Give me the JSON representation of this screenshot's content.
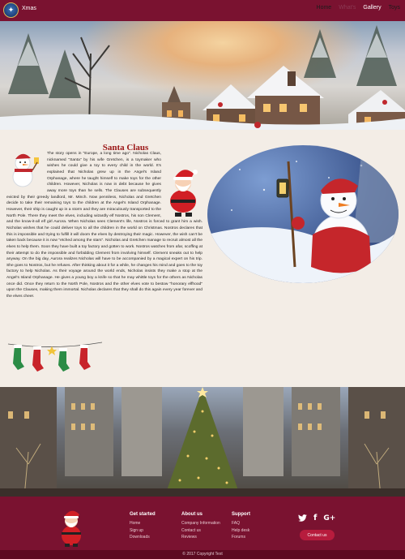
{
  "nav": {
    "brand": "Xmas",
    "items": [
      {
        "label": "Home"
      },
      {
        "label": "What's"
      },
      {
        "label": "Gallery"
      },
      {
        "label": "Toys"
      }
    ]
  },
  "article": {
    "title": "Santa Claus",
    "body": "The story opens in \"Europe, a long time ago\". Nicholas Claus, nicknamed \"Santa\" by his wife Gretchen, is a toymaker who wishes he could give a toy to every child in the world. It's explained that Nicholas grew up in the Angel's Island Orphanage, where he taught himself to make toys for the other children. However, Nicholas is now in debt because he gives away more toys than he sells. The Clauses are subsequently evicted by their greedy landlord, Mr. Minch. Now penniless, Nicholas and Gretchen decide to take their remaining toys to the children at the Angel's Island Orphanage. However, their ship is caught up in a storm and they are miraculously transported to the North Pole. There they meet the elves, including wizardly elf Nostros, his son Clement, and the know-it-all elf girl Aurora. When Nicholas sees Clement's life, Nostros is forced to grant him a wish. Nicholas wishes that he could deliver toys to all the children in the world on Christmas. Nostros declares that this is impossible and trying to fulfill it will doom the elves by destroying their magic. However, the wish can't be taken back because it is now \"etched among the stars\". Nicholas and Gretchen manage to recruit almost all the elves to help them. Soon they have built a toy factory and gotten to work. Nostros watches from afar, scoffing at their attempt to do the impossible and forbidding Clement from involving himself. Clement sneaks out to help anyway. On the big day, Aurora realizes Nicholas will have to be accompanied by a magical expert on his trip. She goes to Nostros, but he refuses. After thinking about it for a while, he changes his mind and goes to the toy factory to help Nicholas. As their voyage around the world ends, Nicholas insists they make a stop at the Angel's Island Orphanage. He gives a young boy a knife so that he may whittle toys for the others as Nicholas once did. Once they return to the North Pole, Nostros and the other elves vote to bestow \"honorary elfhood\" upon the Clauses, making them immortal. Nicholas declares that they shall do this again every year forever and the elves cheer."
  },
  "footer": {
    "columns": [
      {
        "heading": "Get started",
        "links": [
          "Home",
          "Sign up",
          "Downloads"
        ]
      },
      {
        "heading": "About us",
        "links": [
          "Company Information",
          "Contact us",
          "Reviews"
        ]
      },
      {
        "heading": "Support",
        "links": [
          "FAQ",
          "Help desk",
          "Forums"
        ]
      }
    ],
    "social": [
      "twitter-icon",
      "facebook-icon",
      "google-plus-icon"
    ],
    "contact_button": "Contact us",
    "copyright": "© 2017 Copyright Text"
  }
}
